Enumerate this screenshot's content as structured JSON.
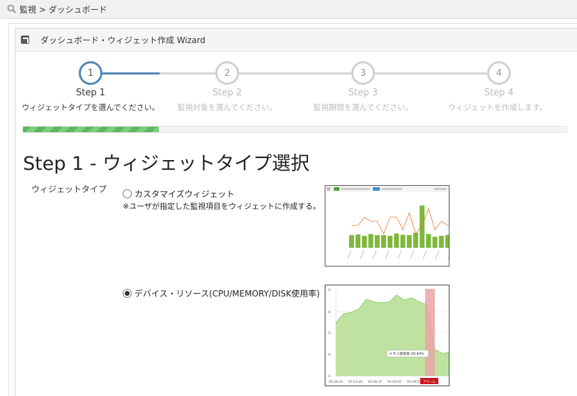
{
  "breadcrumb": {
    "text": "監視 > ダッシュボード"
  },
  "panel": {
    "title": "ダッシュボード・ウィジェット作成 Wizard"
  },
  "steps": [
    {
      "number": "1",
      "title": "Step 1",
      "desc": "ウィジェットタイプを選んでください。"
    },
    {
      "number": "2",
      "title": "Step 2",
      "desc": "監視対象を選んでください。"
    },
    {
      "number": "3",
      "title": "Step 3",
      "desc": "監視期間を選んでください。"
    },
    {
      "number": "4",
      "title": "Step 4",
      "desc": "ウィジェットを作成します。"
    }
  ],
  "progress": {
    "current_step": 1,
    "total_steps": 4,
    "fraction": 0.25
  },
  "heading": "Step 1 - ウィジェットタイプ選択",
  "field": {
    "label": "ウィジェットタイプ"
  },
  "options": [
    {
      "label": "カスタマイズウィジェット",
      "note": "※ユーザが指定した監視項目をウィジェットに作成する。",
      "checked": false
    },
    {
      "label": "デバイス・リソース(CPU/MEMORY/DISK使用率)",
      "checked": true
    }
  ],
  "preview_custom": {
    "bars": [
      0.55,
      0.58,
      0.52,
      0.6,
      0.55,
      0.55,
      0.52,
      0.62,
      0.56,
      0.55,
      0.65,
      0.93,
      0.6,
      0.48,
      0.52,
      0.56,
      0.6,
      0.55
    ]
  },
  "preview_device": {
    "tooltip": "メモリ使用率:39.44%",
    "x_labels": [
      "05:38:41",
      "05:53:40",
      "05:08:37",
      "05:05:05",
      "05:09:05",
      "05:21"
    ],
    "alert_label": "アラーム",
    "colors": {
      "area": "#bfe2a1",
      "line": "#8fcb6a",
      "alert": "#e9a4a4",
      "alert_tag": "#c9181e"
    }
  },
  "colors": {
    "step_active": "#4f86b5",
    "progress": "#5cb85c"
  }
}
